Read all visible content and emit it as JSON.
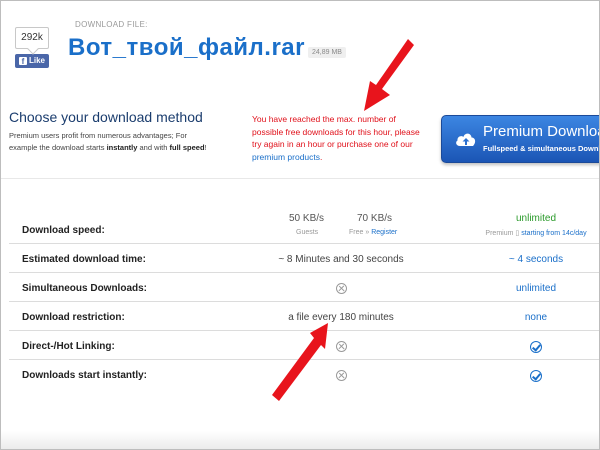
{
  "header": {
    "like_count": "292k",
    "like_label": "Like",
    "download_file_label": "DOWNLOAD FILE:",
    "file_name": "Вот_твой_файл.rar",
    "file_size": "24,89 MB"
  },
  "method": {
    "title": "Choose your download method",
    "desc_part1": "Premium users profit from numerous advantages; For example the download starts ",
    "desc_bold1": "instantly",
    "desc_part2": " and with ",
    "desc_bold2": "full speed",
    "desc_part3": "!"
  },
  "limit_message": {
    "text": "You have reached the max. number of possible free downloads for this hour, please try again in an hour or purchase one of our ",
    "link": "premium products",
    "end": "."
  },
  "premium_button": {
    "title": "Premium Download",
    "subtitle": "Fullspeed & simultaneous Downloads"
  },
  "table": {
    "row_speed": {
      "label": "Download speed:",
      "guest_speed": "50 KB/s",
      "guest_label": "Guests",
      "free_speed": "70 KB/s",
      "free_label": "Free » ",
      "register_link": "Register",
      "premium_value": "unlimited",
      "premium_label": "Premium",
      "premium_link": "starting from 14c/day"
    },
    "row_time": {
      "label": "Estimated download time:",
      "free": "~ 8 Minutes and 30 seconds",
      "premium": "~ 4 seconds"
    },
    "row_simul": {
      "label": "Simultaneous Downloads:",
      "premium": "unlimited"
    },
    "row_restrict": {
      "label": "Download restriction:",
      "free": "a file every 180 minutes",
      "premium": "none"
    },
    "row_hotlink": {
      "label": "Direct-/Hot Linking:"
    },
    "row_instant": {
      "label": "Downloads start instantly:"
    }
  },
  "colors": {
    "link": "#1a6fc9",
    "error": "#e0101a",
    "button": "#2a6fd0",
    "arrow": "#e8141c"
  }
}
